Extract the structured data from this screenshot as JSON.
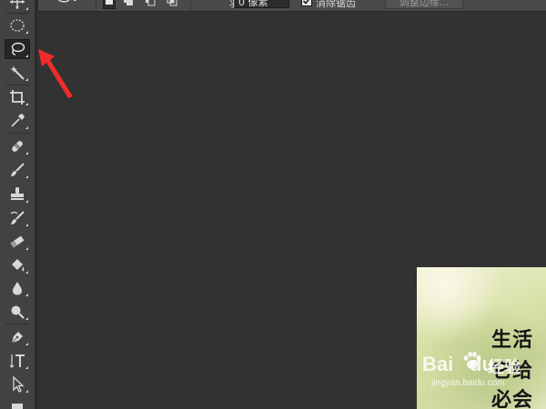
{
  "options_bar": {
    "feather_label": "羽化:",
    "feather_value": "0 像素",
    "anti_alias_label": "消除锯齿",
    "anti_alias_checked": true,
    "refine_edge_label": "调整边缘..."
  },
  "toolbar": {
    "active_tool": "lasso-tool",
    "tools": [
      "move-tool",
      "elliptical-marquee-tool",
      "lasso-tool",
      "magic-wand-tool",
      "crop-tool",
      "eyedropper-tool",
      "spot-healing-brush-tool",
      "brush-tool",
      "clone-stamp-tool",
      "history-brush-tool",
      "eraser-tool",
      "paint-bucket-tool",
      "blur-tool",
      "dodge-tool",
      "pen-tool",
      "type-tool",
      "path-selection-tool",
      "rectangle-tool"
    ]
  },
  "document": {
    "lines": [
      "生活",
      "它给",
      "必会"
    ],
    "watermark": {
      "brand_left": "Bai",
      "brand_right": "du",
      "brand_suffix": "经验",
      "url": "jingyan.baidu.com"
    }
  },
  "colors": {
    "workspace_bg": "#323232",
    "toolbar_bg": "#424242",
    "options_bar_bg": "#4a4a4a",
    "arrow_red": "#f02b2b"
  }
}
